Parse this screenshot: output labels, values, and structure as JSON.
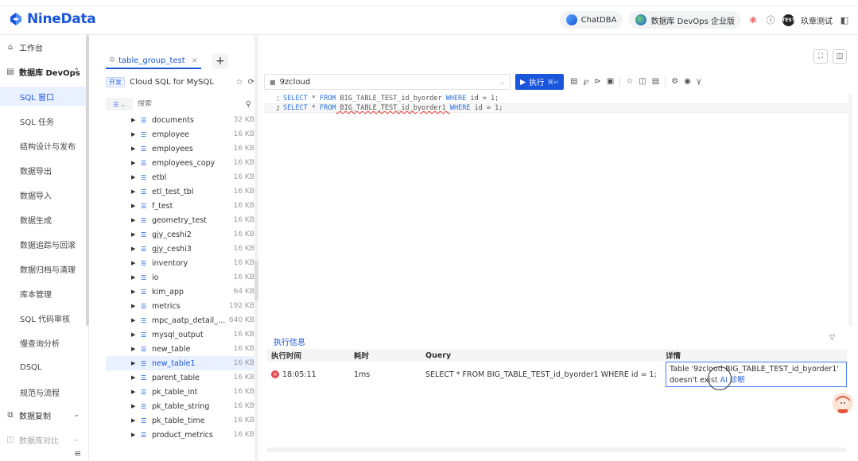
{
  "brand": {
    "name": "NineData"
  },
  "header": {
    "chatdba": "ChatDBA",
    "devops": "数据库 DevOps 企业版",
    "user": "玖章测试",
    "avatar_text": "TEST"
  },
  "nav": {
    "workbench": "工作台",
    "devops_group": "数据库 DevOps",
    "items": [
      "SQL 窗口",
      "SQL 任务",
      "结构设计与发布",
      "数据导出",
      "数据导入",
      "数据生成",
      "数据追踪与回滚",
      "数据归档与清理",
      "库本管理",
      "SQL 代码审核",
      "慢查询分析",
      "DSQL",
      "规范与流程"
    ],
    "replication": "数据复制",
    "compare": "数据库对比"
  },
  "tabs": [
    {
      "label": "table_group_test"
    }
  ],
  "tab_add": "+",
  "db": {
    "env": "开发",
    "name": "Cloud SQL for MySQL",
    "search_placeholder": "搜索"
  },
  "tables": [
    {
      "name": "documents",
      "size": "32 KB"
    },
    {
      "name": "employee",
      "size": "16 KB"
    },
    {
      "name": "employees",
      "size": "16 KB"
    },
    {
      "name": "employees_copy",
      "size": "16 KB"
    },
    {
      "name": "etbl",
      "size": "16 KB"
    },
    {
      "name": "etl_test_tbl",
      "size": "16 KB"
    },
    {
      "name": "f_test",
      "size": "16 KB"
    },
    {
      "name": "geometry_test",
      "size": "16 KB"
    },
    {
      "name": "gjy_ceshi2",
      "size": "16 KB"
    },
    {
      "name": "gjy_ceshi3",
      "size": "16 KB"
    },
    {
      "name": "inventory",
      "size": "16 KB"
    },
    {
      "name": "io",
      "size": "16 KB"
    },
    {
      "name": "kim_app",
      "size": "64 KB"
    },
    {
      "name": "metrics",
      "size": "192 KB"
    },
    {
      "name": "mpc_aatp_detail_his...",
      "size": "640 KB"
    },
    {
      "name": "mysql_output",
      "size": "16 KB"
    },
    {
      "name": "new_table",
      "size": "16 KB"
    },
    {
      "name": "new_table1",
      "size": "16 KB"
    },
    {
      "name": "parent_table",
      "size": "16 KB"
    },
    {
      "name": "pk_table_int",
      "size": "16 KB"
    },
    {
      "name": "pk_table_string",
      "size": "16 KB"
    },
    {
      "name": "pk_table_time",
      "size": "16 KB"
    },
    {
      "name": "product_metrics",
      "size": "16 KB"
    }
  ],
  "editor": {
    "datasource": "9zcloud",
    "run_label": "执行",
    "run_shortcut": "⌘↵",
    "lines": [
      {
        "num": "1",
        "a": "SELECT",
        "b": " * ",
        "c": "FROM",
        "d": " BIG_TABLE_TEST_id_byorder ",
        "e": "WHERE",
        "f": " id = 1;"
      },
      {
        "num": "2",
        "a": "SELECT",
        "b": " * ",
        "c": "FROM",
        "d": " BIG_TABLE_TEST_id_byorder1 ",
        "e": "WHERE",
        "f": " id = 1;"
      }
    ]
  },
  "result": {
    "tab": "执行信息",
    "headers": {
      "time": "执行时间",
      "duration": "耗时",
      "query": "Query",
      "detail": "详情"
    },
    "row": {
      "time": "18:05:11",
      "duration": "1ms",
      "query": "SELECT * FROM BIG_TABLE_TEST_id_byorder1 WHERE id = 1;",
      "detail": "Table '9zcloud.BIG_TABLE_TEST_id_byorder1' doesn't exist",
      "ai": "AI 诊断"
    }
  },
  "colors": {
    "brand": "#1a56db",
    "error": "#e5484d",
    "selected_bg": "#e9f0ff"
  }
}
